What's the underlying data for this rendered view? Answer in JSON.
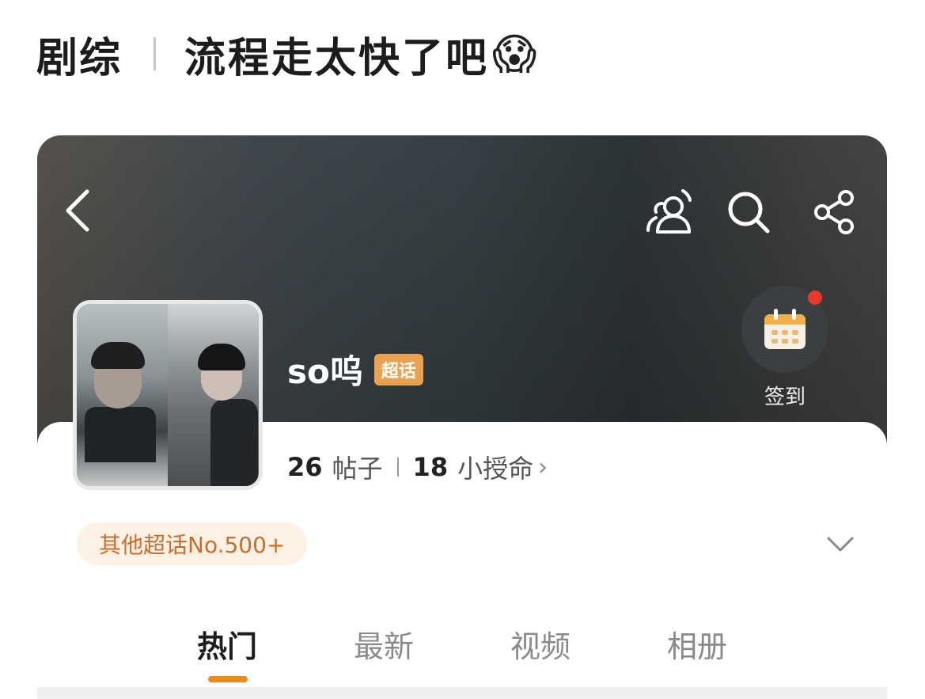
{
  "headline": {
    "tag": "剧综",
    "title": "流程走太快了吧",
    "emoji": "😱"
  },
  "nav": {
    "back_icon": "chevron-left-icon",
    "fans_icon": "group-icon",
    "search_icon": "search-icon",
    "share_icon": "share-icon"
  },
  "checkin": {
    "label": "签到",
    "icon": "calendar-icon"
  },
  "topic": {
    "name": "so呜",
    "badge": "超话"
  },
  "stats": {
    "posts_count": "26",
    "posts_label": "帖子",
    "members_count": "18",
    "members_label": "小授命",
    "chevron": "›"
  },
  "rank": {
    "text": "其他超话No.500+"
  },
  "tabs": [
    {
      "label": "热门",
      "active": true
    },
    {
      "label": "最新",
      "active": false
    },
    {
      "label": "视频",
      "active": false
    },
    {
      "label": "相册",
      "active": false
    }
  ],
  "colors": {
    "accent": "#f08a1c",
    "badge": "#e9a350",
    "rank_text": "#c86e2c",
    "rank_bg": "#fdf1e6",
    "notification_dot": "#e8392c"
  }
}
